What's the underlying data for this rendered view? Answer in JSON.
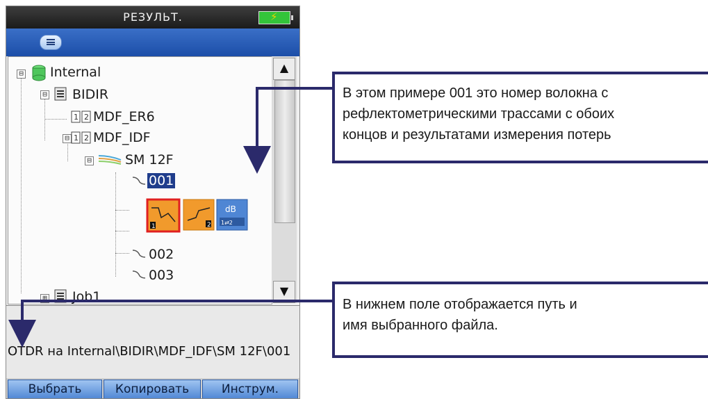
{
  "device": {
    "title": "РЕЗУЛЬТ.",
    "battery_icon": "battery-charging-icon",
    "menu_icon": "menu-icon"
  },
  "tree": {
    "root": "Internal",
    "bidir": "BIDIR",
    "mdf_er6": "MDF_ER6",
    "mdf_idf": "MDF_IDF",
    "sm12f": "SM 12F",
    "fiber_001": "001",
    "fiber_002": "002",
    "fiber_003": "003",
    "job1": "Job1",
    "expander_minus": "⊟",
    "expander_plus": "⊞",
    "result_icons": [
      "otdr-trace-1-icon",
      "otdr-trace-2-icon",
      "loss-db-icon"
    ],
    "db_label": "dB"
  },
  "scroll": {
    "up": "▲",
    "down": "▼"
  },
  "path_text": "OTDR на Internal\\BIDIR\\MDF_IDF\\SM 12F\\001",
  "buttons": {
    "select": "Выбрать",
    "copy": "Копировать",
    "tools": "Инструм."
  },
  "callouts": {
    "top": "В этом примере 001 это номер волокна с\nрефлектометрическими трассами с обоих\nконцов и результатами измерения потерь",
    "bottom": "В нижнем поле отображается путь и\nимя выбранного файла."
  },
  "colors": {
    "callout_border": "#2b2a6b",
    "toolbar": "#2a5fbe",
    "selection": "#1f3d8c",
    "battery": "#33c43a"
  }
}
